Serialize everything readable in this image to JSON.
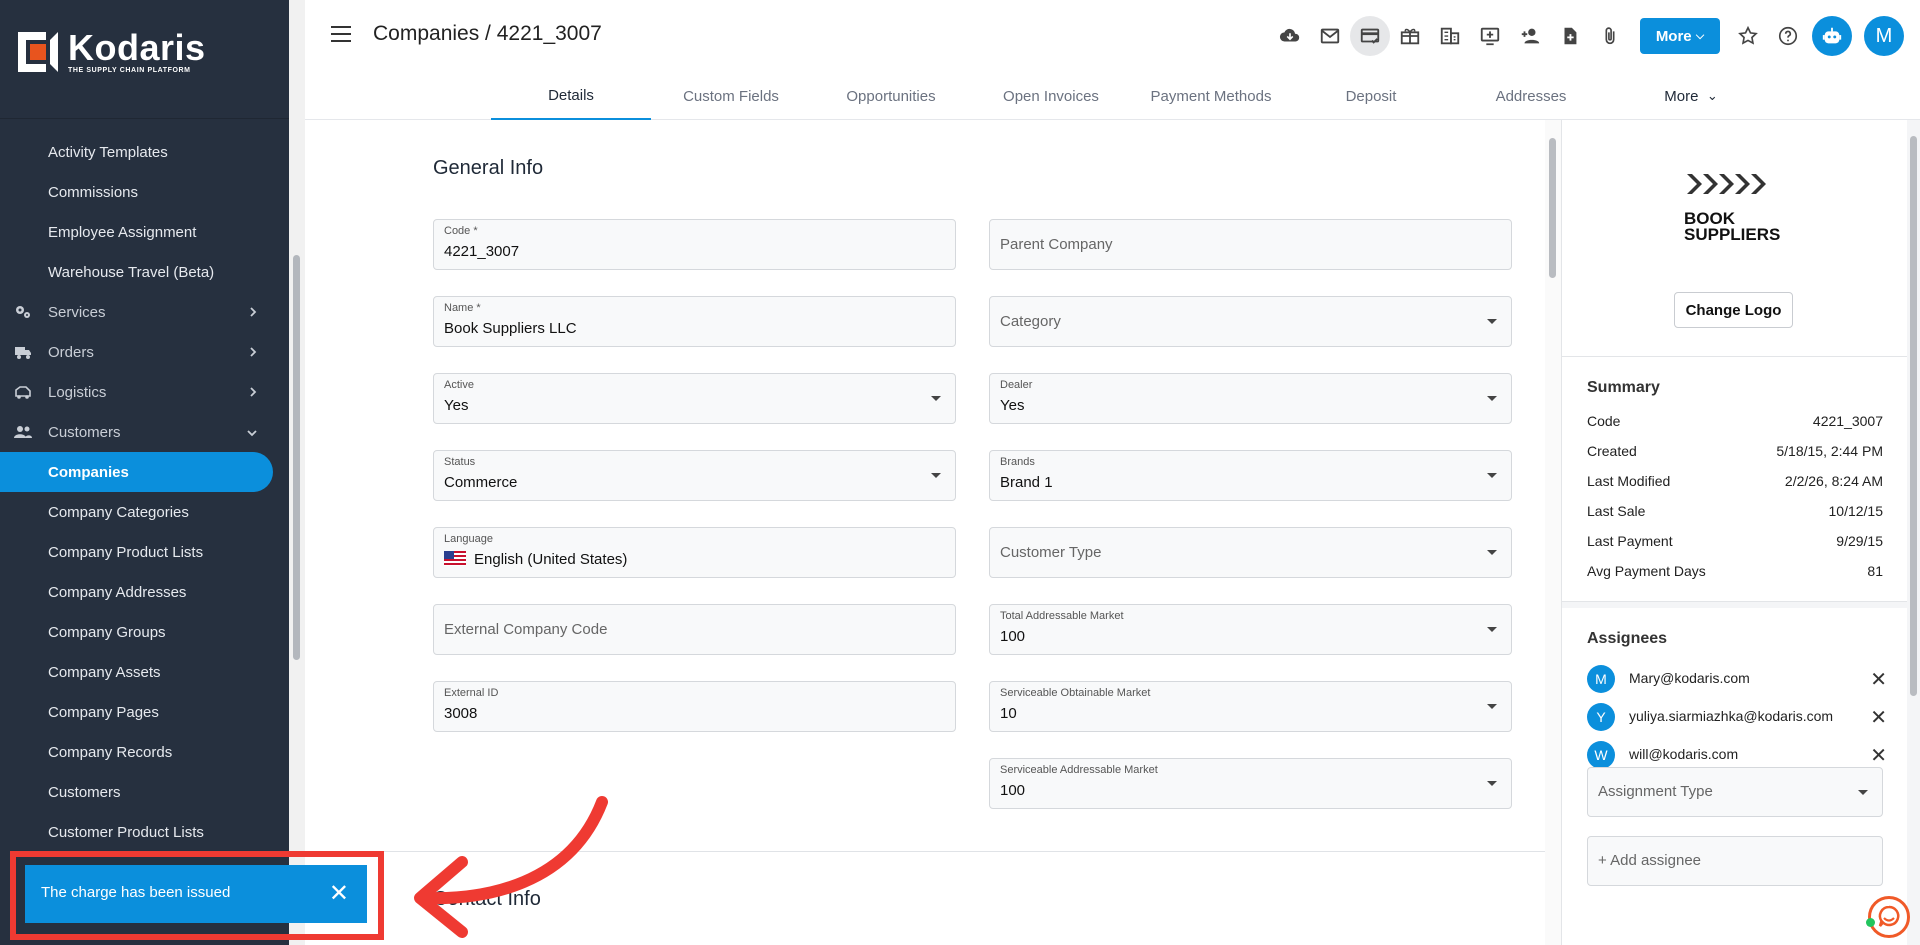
{
  "brand": {
    "name": "Kodaris",
    "tagline": "THE SUPPLY CHAIN PLATFORM",
    "accent": "#0b8fdc"
  },
  "header": {
    "title": "Companies / 4221_3007",
    "more_label": "More",
    "avatar_initial": "M"
  },
  "toolbar_icons": [
    "cloud-download-icon",
    "mail-icon",
    "payment-card-icon",
    "gift-icon",
    "building-icon",
    "add-to-screen-icon",
    "add-person-icon",
    "add-file-icon",
    "attachment-icon",
    "star-icon",
    "help-icon",
    "robot-icon"
  ],
  "sidebar": {
    "items": [
      {
        "label": "Activity Templates",
        "type": "sub"
      },
      {
        "label": "Commissions",
        "type": "sub"
      },
      {
        "label": "Employee Assignment",
        "type": "sub"
      },
      {
        "label": "Warehouse Travel (Beta)",
        "type": "sub"
      },
      {
        "label": "Services",
        "type": "section",
        "icon": "services-icon"
      },
      {
        "label": "Orders",
        "type": "section",
        "icon": "truck-icon"
      },
      {
        "label": "Logistics",
        "type": "section",
        "icon": "logistics-icon"
      },
      {
        "label": "Customers",
        "type": "section-open",
        "icon": "people-icon"
      },
      {
        "label": "Companies",
        "type": "active"
      },
      {
        "label": "Company Categories",
        "type": "sub"
      },
      {
        "label": "Company Product Lists",
        "type": "sub"
      },
      {
        "label": "Company Addresses",
        "type": "sub"
      },
      {
        "label": "Company Groups",
        "type": "sub"
      },
      {
        "label": "Company Assets",
        "type": "sub"
      },
      {
        "label": "Company Pages",
        "type": "sub"
      },
      {
        "label": "Company Records",
        "type": "sub"
      },
      {
        "label": "Customers",
        "type": "sub"
      },
      {
        "label": "Customer Product Lists",
        "type": "sub"
      }
    ]
  },
  "tabs": [
    "Details",
    "Custom Fields",
    "Opportunities",
    "Open Invoices",
    "Payment Methods",
    "Deposit",
    "Addresses",
    "More"
  ],
  "main": {
    "general_info_title": "General Info",
    "contact_info_title": "Contact Info",
    "left_fields": [
      {
        "label": "Code *",
        "value": "4221_3007",
        "dropdown": false
      },
      {
        "label": "Name *",
        "value": "Book Suppliers LLC",
        "dropdown": false
      },
      {
        "label": "Active",
        "value": "Yes",
        "dropdown": true
      },
      {
        "label": "Status",
        "value": "Commerce",
        "dropdown": true
      },
      {
        "label": "Language",
        "value": "English (United States)",
        "dropdown": false
      },
      {
        "label": "",
        "placeholder": "External Company Code",
        "dropdown": false
      },
      {
        "label": "External ID",
        "value": "3008",
        "dropdown": false
      }
    ],
    "right_fields": [
      {
        "label": "",
        "placeholder": "Parent Company",
        "dropdown": false
      },
      {
        "label": "",
        "placeholder": "Category",
        "dropdown": true
      },
      {
        "label": "Dealer",
        "value": "Yes",
        "dropdown": true
      },
      {
        "label": "Brands",
        "value": "Brand 1",
        "dropdown": true
      },
      {
        "label": "",
        "placeholder": "Customer Type",
        "dropdown": true
      },
      {
        "label": "Total Addressable Market",
        "value": "100",
        "dropdown": true
      },
      {
        "label": "Serviceable Obtainable Market",
        "value": "10",
        "dropdown": true
      },
      {
        "label": "Serviceable Addressable Market",
        "value": "100",
        "dropdown": true
      }
    ]
  },
  "panel": {
    "logo_line1": "BOOK",
    "logo_line2": "SUPPLIERS",
    "change_logo_label": "Change Logo",
    "summary_title": "Summary",
    "summary": [
      {
        "key": "Code",
        "value": "4221_3007"
      },
      {
        "key": "Created",
        "value": "5/18/15, 2:44 PM"
      },
      {
        "key": "Last Modified",
        "value": "2/2/26, 8:24 AM"
      },
      {
        "key": "Last Sale",
        "value": "10/12/15"
      },
      {
        "key": "Last Payment",
        "value": "9/29/15"
      },
      {
        "key": "Avg Payment Days",
        "value": "81"
      }
    ],
    "assignees_title": "Assignees",
    "assignees": [
      {
        "initial": "M",
        "email": "Mary@kodaris.com"
      },
      {
        "initial": "Y",
        "email": "yuliya.siarmiazhka@kodaris.com"
      },
      {
        "initial": "W",
        "email": "will@kodaris.com"
      }
    ],
    "assignment_type_placeholder": "Assignment Type",
    "add_assignee_placeholder": "+ Add assignee"
  },
  "toast": {
    "message": "The charge has been issued",
    "close": "✕"
  }
}
